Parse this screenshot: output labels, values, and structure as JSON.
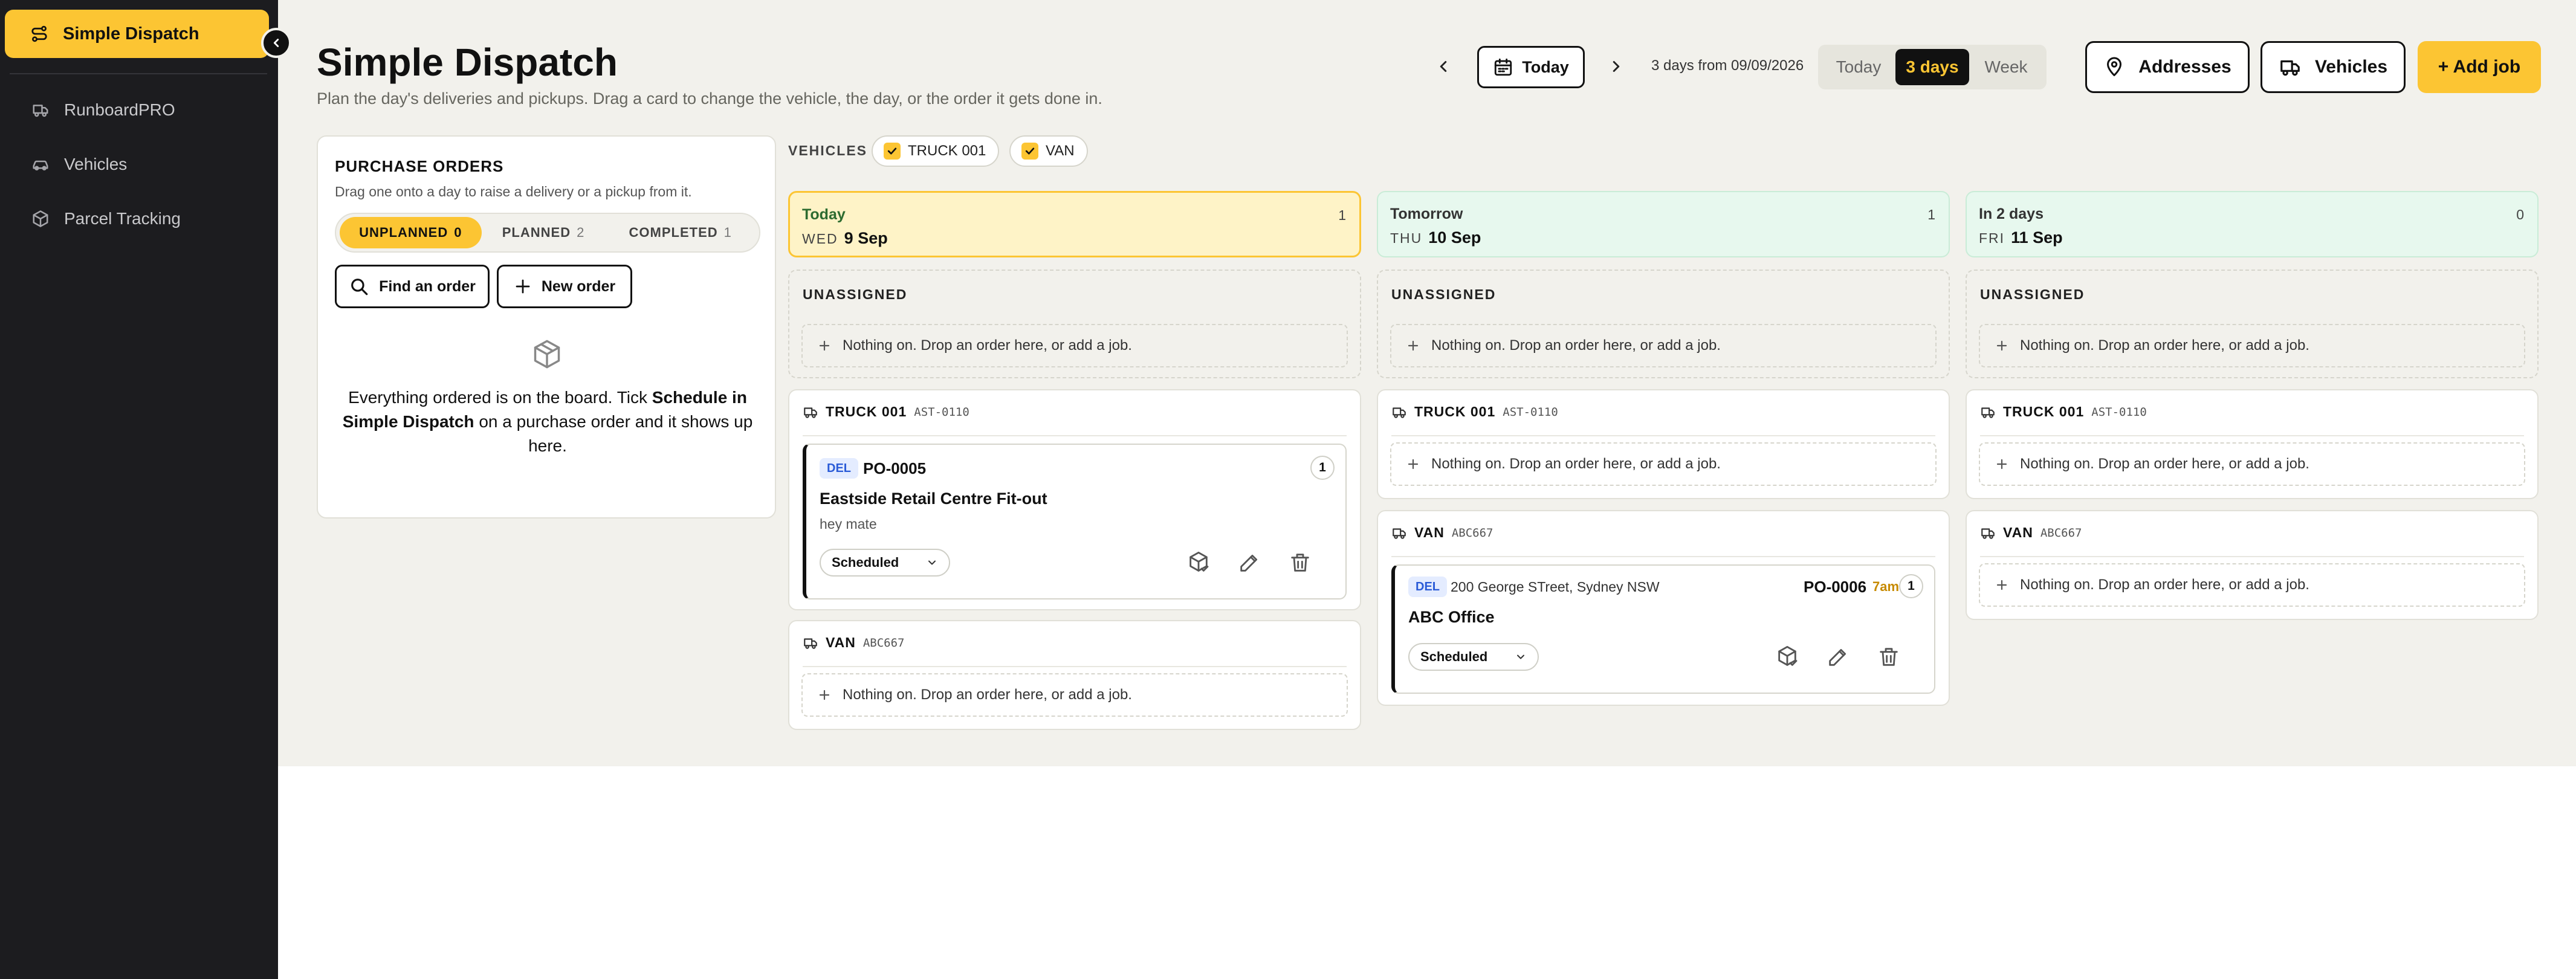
{
  "sidebar": {
    "active": {
      "label": "Simple Dispatch",
      "icon": "route-icon"
    },
    "items": [
      {
        "label": "RunboardPRO",
        "icon": "truck-icon"
      },
      {
        "label": "Vehicles",
        "icon": "car-icon"
      },
      {
        "label": "Parcel Tracking",
        "icon": "package-icon"
      }
    ]
  },
  "header": {
    "title": "Simple Dispatch",
    "subtitle": "Plan the day's deliveries and pickups. Drag a card to change the vehicle, the day, or the order it gets done in.",
    "today_label": "Today",
    "range_text": "3 days from 09/09/2026",
    "view_options": [
      "Today",
      "3 days",
      "Week"
    ],
    "selected_view": "3 days",
    "addresses_label": "Addresses",
    "vehicles_label": "Vehicles",
    "add_job_label": "+ Add job"
  },
  "purchase_orders": {
    "title": "PURCHASE ORDERS",
    "subtitle": "Drag one onto a day to raise a delivery or a pickup from it.",
    "tabs": [
      {
        "label": "UNPLANNED",
        "count": "0",
        "active": true
      },
      {
        "label": "PLANNED",
        "count": "2",
        "active": false
      },
      {
        "label": "COMPLETED",
        "count": "1",
        "active": false
      }
    ],
    "find_label": "Find an order",
    "new_label": "New order",
    "empty_pre": "Everything ordered is on the board. Tick ",
    "empty_bold": "Schedule in Simple Dispatch",
    "empty_post": " on a purchase order and it shows up here."
  },
  "vehicle_filter": {
    "label": "VEHICLES",
    "chips": [
      {
        "label": "TRUCK 001",
        "checked": true
      },
      {
        "label": "VAN",
        "checked": true
      }
    ]
  },
  "board": {
    "unassigned_label": "UNASSIGNED",
    "empty_drop": "Nothing on. Drop an order here, or add a job.",
    "days": [
      {
        "title": "Today",
        "dow": "WED",
        "date": "9 Sep",
        "count": "1",
        "vehicles": [
          {
            "name": "TRUCK 001",
            "code": "AST-0110",
            "job": {
              "type": "DEL",
              "po": "PO-0005",
              "seq": "1",
              "title": "Eastside Retail Centre Fit-out",
              "note": "hey mate",
              "status": "Scheduled"
            }
          },
          {
            "name": "VAN",
            "code": "ABC667",
            "job": null
          }
        ]
      },
      {
        "title": "Tomorrow",
        "dow": "THU",
        "date": "10 Sep",
        "count": "1",
        "vehicles": [
          {
            "name": "TRUCK 001",
            "code": "AST-0110",
            "job": null
          },
          {
            "name": "VAN",
            "code": "ABC667",
            "job": {
              "type": "DEL",
              "address": "200 George STreet, Sydney NSW",
              "po": "PO-0006",
              "time": "7am",
              "seq": "1",
              "title": "ABC Office",
              "status": "Scheduled"
            }
          }
        ]
      },
      {
        "title": "In 2 days",
        "dow": "FRI",
        "date": "11 Sep",
        "count": "0",
        "vehicles": [
          {
            "name": "TRUCK 001",
            "code": "AST-0110",
            "job": null
          },
          {
            "name": "VAN",
            "code": "ABC667",
            "job": null
          }
        ]
      }
    ]
  },
  "colors": {
    "accent": "#fcc533",
    "sidebar": "#1c1c1f",
    "today_bg": "#fef3c7",
    "future_bg": "#e7f8ee",
    "delivery_badge": "#2a5bd7"
  }
}
